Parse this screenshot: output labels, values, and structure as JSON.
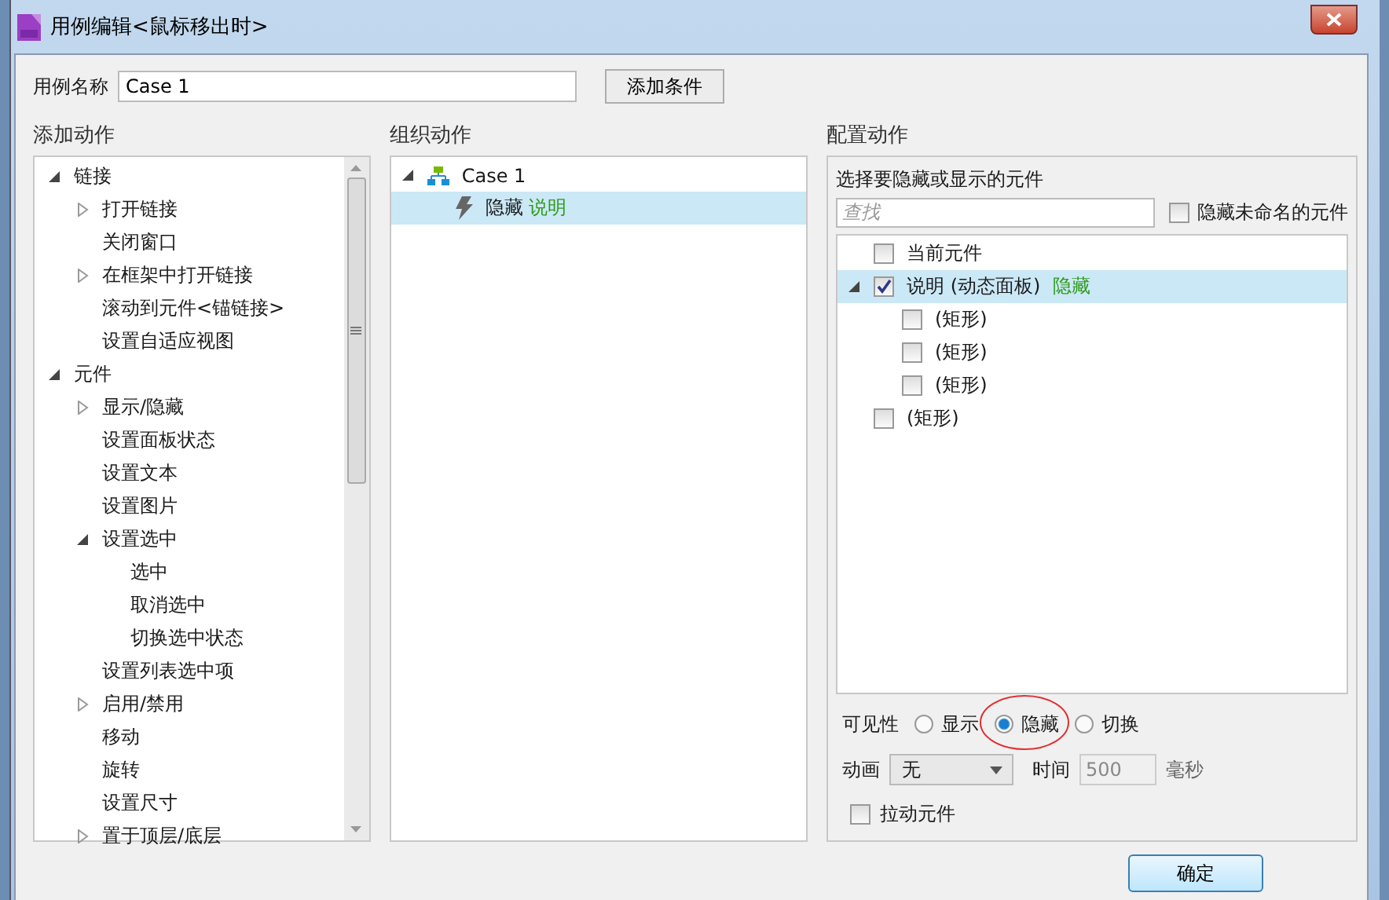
{
  "window": {
    "title": "用例编辑<鼠标移出时>"
  },
  "case_name": {
    "label": "用例名称",
    "value": "Case 1"
  },
  "add_condition_button": "添加条件",
  "add_action": {
    "heading": "添加动作",
    "items": [
      {
        "label": "链接",
        "expanded": true,
        "children": [
          {
            "label": "打开链接",
            "expanded": false
          },
          {
            "label": "关闭窗口"
          },
          {
            "label": "在框架中打开链接",
            "expanded": false
          },
          {
            "label": "滚动到元件<锚链接>"
          },
          {
            "label": "设置自适应视图"
          }
        ]
      },
      {
        "label": "元件",
        "expanded": true,
        "children": [
          {
            "label": "显示/隐藏",
            "expanded": false
          },
          {
            "label": "设置面板状态"
          },
          {
            "label": "设置文本"
          },
          {
            "label": "设置图片"
          },
          {
            "label": "设置选中",
            "expanded": true,
            "children": [
              {
                "label": "选中"
              },
              {
                "label": "取消选中"
              },
              {
                "label": "切换选中状态"
              }
            ]
          },
          {
            "label": "设置列表选中项"
          },
          {
            "label": "启用/禁用",
            "expanded": false
          },
          {
            "label": "移动"
          },
          {
            "label": "旋转"
          },
          {
            "label": "设置尺寸"
          },
          {
            "label": "置于顶层/底层",
            "expanded": false
          }
        ]
      }
    ]
  },
  "organize": {
    "heading": "组织动作",
    "case": {
      "label": "Case 1",
      "expanded": true
    },
    "actions": [
      {
        "verb": "隐藏",
        "target": "说明",
        "selected": true
      }
    ]
  },
  "configure": {
    "heading": "配置动作",
    "prompt": "选择要隐藏或显示的元件",
    "search": {
      "placeholder": "查找"
    },
    "hide_unnamed": {
      "label": "隐藏未命名的元件",
      "checked": false
    },
    "elements": [
      {
        "label": "当前元件",
        "checked": false,
        "selected": false
      },
      {
        "label": "说明 (动态面板)",
        "status": "隐藏",
        "checked": true,
        "selected": true,
        "expanded": true,
        "children": [
          {
            "label": "(矩形)",
            "checked": false,
            "selected": false
          },
          {
            "label": "(矩形)",
            "checked": false,
            "selected": false
          },
          {
            "label": "(矩形)",
            "checked": false,
            "selected": false
          }
        ]
      },
      {
        "label": "(矩形)",
        "checked": false,
        "selected": false
      }
    ],
    "visibility": {
      "label": "可见性",
      "options": [
        {
          "label": "显示",
          "selected": false
        },
        {
          "label": "隐藏",
          "selected": true,
          "circled": true
        },
        {
          "label": "切换",
          "selected": false
        }
      ]
    },
    "animation": {
      "label": "动画",
      "value": "无"
    },
    "time": {
      "label": "时间",
      "value": "500",
      "unit": "毫秒",
      "disabled": true
    },
    "drag": {
      "label": "拉动元件",
      "checked": false
    }
  },
  "ok_button": "确定"
}
